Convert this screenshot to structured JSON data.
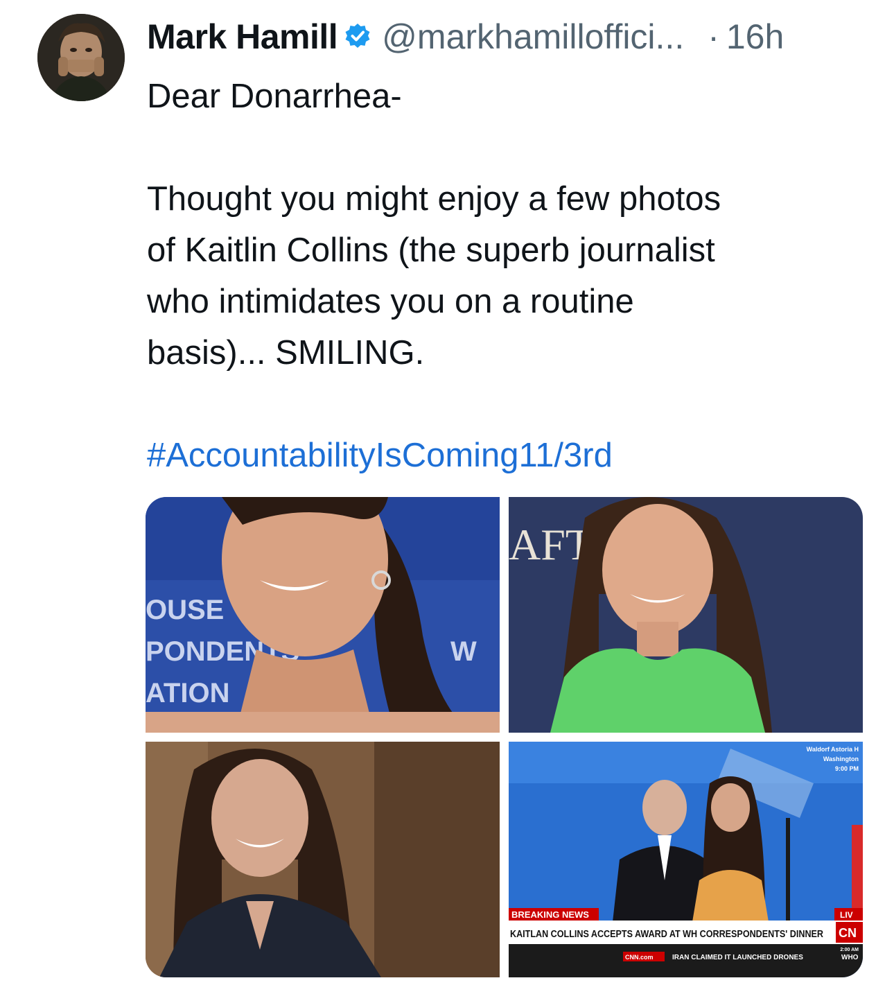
{
  "tweet": {
    "author_name": "Mark Hamill",
    "handle": "@markhamilloffici...",
    "separator": "·",
    "time": "16h",
    "verified": true,
    "paragraphs": [
      "Dear Donarrhea-",
      "Thought you might enjoy a few photos\nof Kaitlin Collins (the superb journalist\nwho intimidates you on a routine\nbasis)... SMILING."
    ],
    "hashtag": "#AccountabilityIsComing11/3rd"
  },
  "media": {
    "photo1": {
      "backdrop_text_1": "OUSE",
      "backdrop_text_2": "PONDENTS",
      "backdrop_text_3": "ATION",
      "backdrop_text_4": "W"
    },
    "photo2": {
      "backdrop_text": "AFT"
    },
    "photo4": {
      "banner_label": "BREAKING NEWS",
      "headline": "KAITLAN COLLINS ACCEPTS AWARD AT WH CORRESPONDENTS' DINNER",
      "live_label": "LIV",
      "network_logo": "CN",
      "location_line_1": "Waldorf Astoria H",
      "location_line_2": "Washington",
      "location_line_3": "9:00 PM",
      "ticker_time": "2:00 AM",
      "ticker_site": "CNN.com",
      "ticker_text": "IRAN CLAIMED IT LAUNCHED DRONES",
      "ticker_right": "WHO"
    }
  },
  "colors": {
    "verified_blue": "#1d9bf0",
    "hashtag_blue": "#1d6fd6",
    "cnn_red": "#cc0000",
    "secondary_gray": "#536471"
  },
  "icons": {
    "verified": "verified-badge-icon"
  }
}
